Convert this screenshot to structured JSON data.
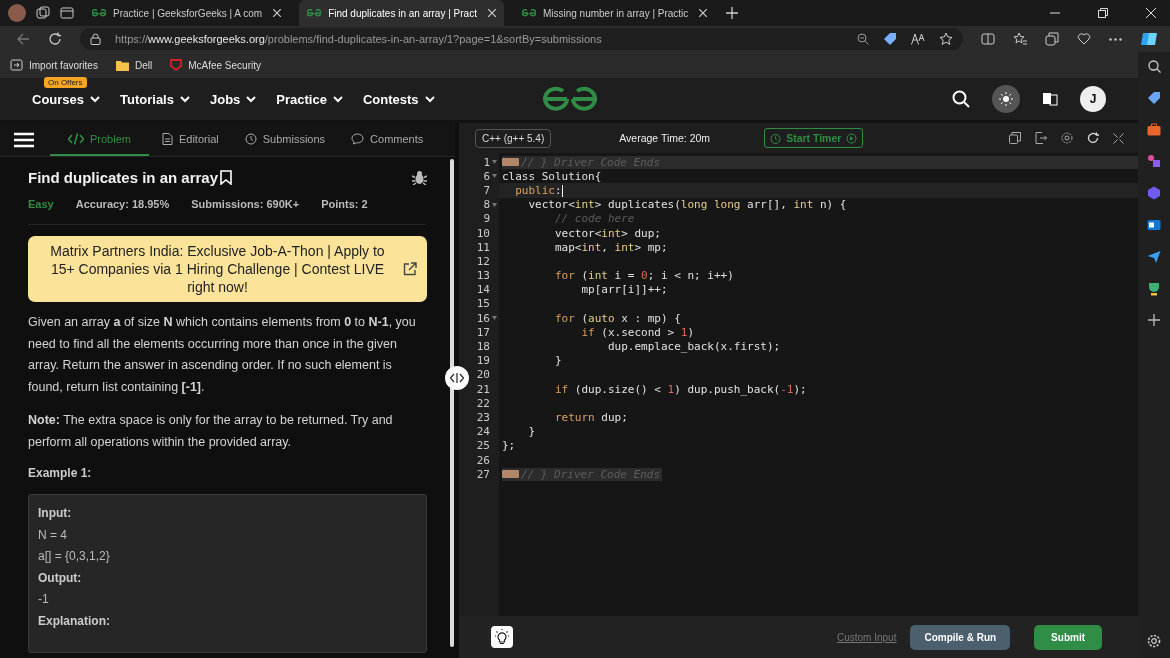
{
  "browser": {
    "tabs": [
      {
        "title": "Practice | GeeksforGeeks | A com",
        "selected": false
      },
      {
        "title": "Find duplicates in an array | Pract",
        "selected": true
      },
      {
        "title": "Missing number in array | Practic",
        "selected": false
      }
    ],
    "url": {
      "scheme": "https://",
      "domain": "www.geeksforgeeks.org",
      "path": "/problems/find-duplicates-in-an-array/1?page=1&sortBy=submissions"
    },
    "favorites": [
      "Import favorites",
      "Dell",
      "McAfee Security"
    ]
  },
  "site_header": {
    "nav": [
      {
        "label": "Courses",
        "badge": "On Offers"
      },
      {
        "label": "Tutorials"
      },
      {
        "label": "Jobs"
      },
      {
        "label": "Practice"
      },
      {
        "label": "Contests"
      }
    ],
    "avatar": "J"
  },
  "left_panel": {
    "tabs": [
      {
        "label": "Problem",
        "selected": true
      },
      {
        "label": "Editorial",
        "selected": false
      },
      {
        "label": "Submissions",
        "selected": false
      },
      {
        "label": "Comments",
        "selected": false
      }
    ],
    "title": "Find duplicates in an array",
    "difficulty": "Easy",
    "stats": [
      "Accuracy: 18.95%",
      "Submissions: 690K+",
      "Points: 2"
    ],
    "banner": "Matrix Partners India: Exclusive Job-A-Thon | Apply to 15+ Companies via 1 Hiring Challenge | Contest LIVE right now!",
    "paragraphs": [
      "Given an array **a** of size **N** which contains elements from **0** to **N-1**, you need to find all the elements occurring more than once in the given array. Return the answer in ascending order. If no such element is found, return list containing **[-1]**.",
      "**Note:** The extra space is only for the array to be returned. Try and perform all operations within the provided array."
    ],
    "example_heading": "Example 1:",
    "example_lines": [
      {
        "kind": "label",
        "text": "Input:"
      },
      {
        "kind": "value",
        "text": "N = 4"
      },
      {
        "kind": "value",
        "text": "a[] = {0,3,1,2}"
      },
      {
        "kind": "label",
        "text": "Output:"
      },
      {
        "kind": "value",
        "text": "-1"
      },
      {
        "kind": "label",
        "text": "Explanation:"
      }
    ]
  },
  "editor": {
    "language": "C++ (g++ 5.4)",
    "average_time": "Average Time: 20m",
    "timer_button": "Start Timer",
    "lines": [
      {
        "number": "1",
        "kind": "folded",
        "fold_arrow": true,
        "tokens": [
          {
            "kind": "comment",
            "text": "// } Driver Code Ends"
          }
        ]
      },
      {
        "number": "6",
        "kind": "code",
        "fold_arrow": true,
        "tokens": [
          {
            "kind": "plain",
            "text": "class Solution{"
          }
        ]
      },
      {
        "number": "7",
        "kind": "code",
        "current": true,
        "tokens": [
          {
            "kind": "kw",
            "text": "  public"
          },
          {
            "kind": "plain",
            "text": ":"
          }
        ]
      },
      {
        "number": "8",
        "kind": "code",
        "fold_arrow": true,
        "tokens": [
          {
            "kind": "plain",
            "text": "    vector<"
          },
          {
            "kind": "type",
            "text": "int"
          },
          {
            "kind": "plain",
            "text": "> duplicates("
          },
          {
            "kind": "type",
            "text": "long long"
          },
          {
            "kind": "plain",
            "text": " arr[], "
          },
          {
            "kind": "type",
            "text": "int"
          },
          {
            "kind": "plain",
            "text": " n) {"
          }
        ]
      },
      {
        "number": "9",
        "kind": "code",
        "tokens": [
          {
            "kind": "comment",
            "text": "        // code here"
          }
        ]
      },
      {
        "number": "10",
        "kind": "code",
        "tokens": [
          {
            "kind": "plain",
            "text": "        vector<"
          },
          {
            "kind": "type",
            "text": "int"
          },
          {
            "kind": "plain",
            "text": "> dup;"
          }
        ]
      },
      {
        "number": "11",
        "kind": "code",
        "tokens": [
          {
            "kind": "plain",
            "text": "        map<"
          },
          {
            "kind": "type",
            "text": "int"
          },
          {
            "kind": "plain",
            "text": ", "
          },
          {
            "kind": "type",
            "text": "int"
          },
          {
            "kind": "plain",
            "text": "> mp;"
          }
        ]
      },
      {
        "number": "12",
        "kind": "code"
      },
      {
        "number": "13",
        "kind": "code",
        "tokens": [
          {
            "kind": "kw",
            "text": "        for"
          },
          {
            "kind": "plain",
            "text": " ("
          },
          {
            "kind": "type",
            "text": "int"
          },
          {
            "kind": "plain",
            "text": " i = "
          },
          {
            "kind": "num",
            "text": "0"
          },
          {
            "kind": "plain",
            "text": "; i < n; i++)"
          }
        ]
      },
      {
        "number": "14",
        "kind": "code",
        "tokens": [
          {
            "kind": "plain",
            "text": "            mp[arr[i]]++;"
          }
        ]
      },
      {
        "number": "15",
        "kind": "code"
      },
      {
        "number": "16",
        "kind": "code",
        "fold_arrow": true,
        "tokens": [
          {
            "kind": "kw",
            "text": "        for"
          },
          {
            "kind": "plain",
            "text": " ("
          },
          {
            "kind": "type",
            "text": "auto"
          },
          {
            "kind": "plain",
            "text": " x : mp) {"
          }
        ]
      },
      {
        "number": "17",
        "kind": "code",
        "tokens": [
          {
            "kind": "kw",
            "text": "            if"
          },
          {
            "kind": "plain",
            "text": " (x.second > "
          },
          {
            "kind": "num",
            "text": "1"
          },
          {
            "kind": "plain",
            "text": ")"
          }
        ]
      },
      {
        "number": "18",
        "kind": "code",
        "tokens": [
          {
            "kind": "plain",
            "text": "                dup.emplace_back(x.first);"
          }
        ]
      },
      {
        "number": "19",
        "kind": "code",
        "tokens": [
          {
            "kind": "plain",
            "text": "        }"
          }
        ]
      },
      {
        "number": "20",
        "kind": "code"
      },
      {
        "number": "21",
        "kind": "code",
        "tokens": [
          {
            "kind": "kw",
            "text": "        if"
          },
          {
            "kind": "plain",
            "text": " (dup.size() < "
          },
          {
            "kind": "num",
            "text": "1"
          },
          {
            "kind": "plain",
            "text": ") dup.push_back("
          },
          {
            "kind": "num",
            "text": "-1"
          },
          {
            "kind": "plain",
            "text": ");"
          }
        ]
      },
      {
        "number": "22",
        "kind": "code"
      },
      {
        "number": "23",
        "kind": "code",
        "tokens": [
          {
            "kind": "kw",
            "text": "        return"
          },
          {
            "kind": "plain",
            "text": " dup;"
          }
        ]
      },
      {
        "number": "24",
        "kind": "code",
        "tokens": [
          {
            "kind": "plain",
            "text": "    }"
          }
        ]
      },
      {
        "number": "25",
        "kind": "code",
        "tokens": [
          {
            "kind": "plain",
            "text": "};"
          }
        ]
      },
      {
        "number": "26",
        "kind": "code"
      },
      {
        "number": "27",
        "kind": "folded",
        "tokens": [
          {
            "kind": "comment",
            "text": "// } Driver Code Ends"
          }
        ]
      }
    ],
    "custom_input": "Custom Input",
    "compile_button": "Compile & Run",
    "submit_button": "Submit"
  }
}
